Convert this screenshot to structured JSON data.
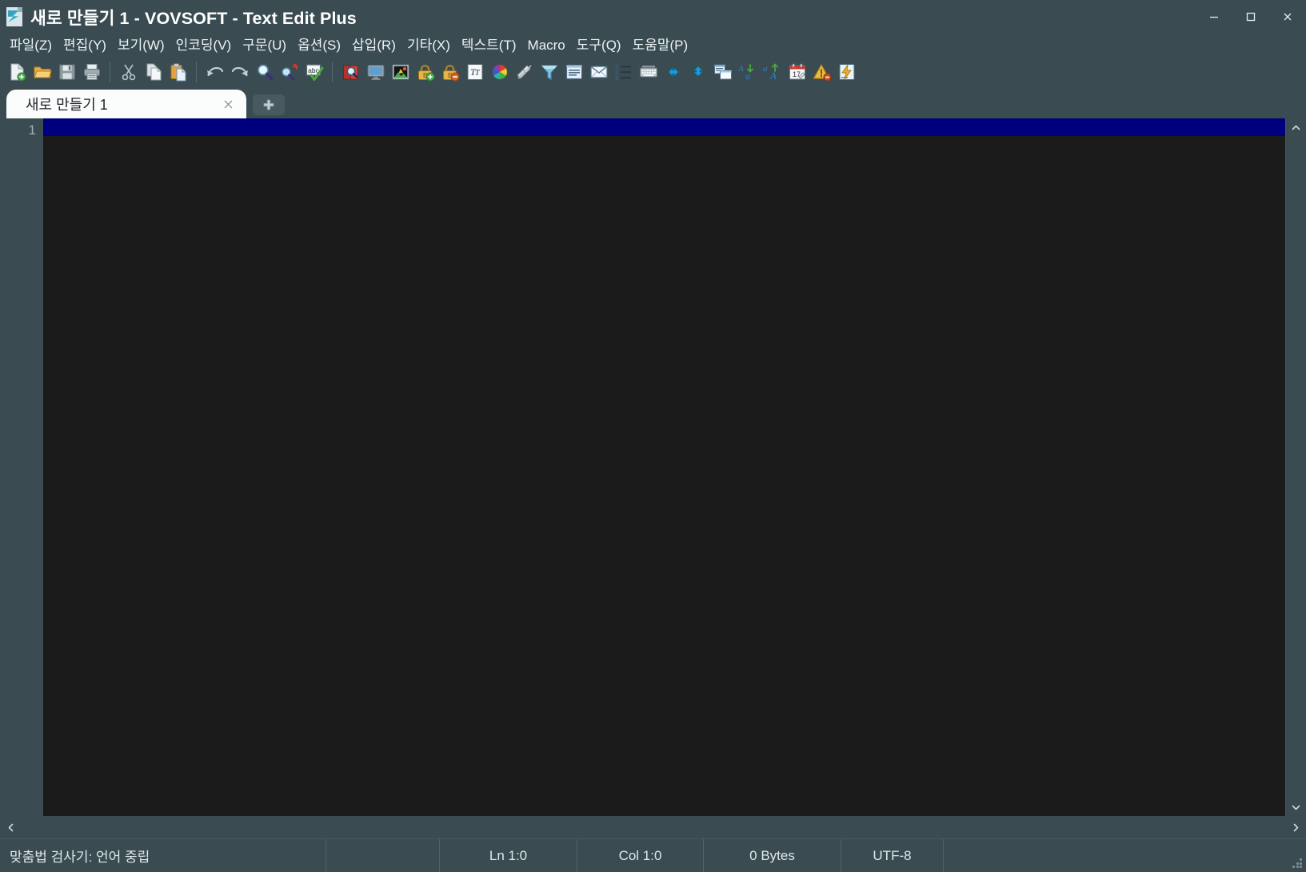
{
  "window": {
    "title": "새로 만들기 1 - VOVSOFT - Text Edit Plus",
    "icon": "document-app-icon",
    "controls": {
      "minimize": "minimize-button",
      "maximize": "maximize-button",
      "close": "close-button"
    },
    "background_color": "#3a4b52"
  },
  "menubar": {
    "items": [
      {
        "label": "파일(Z)"
      },
      {
        "label": "편집(Y)"
      },
      {
        "label": "보기(W)"
      },
      {
        "label": "인코딩(V)"
      },
      {
        "label": "구문(U)"
      },
      {
        "label": "옵션(S)"
      },
      {
        "label": "삽입(R)"
      },
      {
        "label": "기타(X)"
      },
      {
        "label": "텍스트(T)"
      },
      {
        "label": "Macro"
      },
      {
        "label": "도구(Q)"
      },
      {
        "label": "도움말(P)"
      }
    ]
  },
  "toolbar": {
    "groups": [
      {
        "buttons": [
          {
            "icon": "new-file-icon"
          },
          {
            "icon": "open-folder-icon"
          },
          {
            "icon": "save-icon"
          },
          {
            "icon": "print-icon"
          }
        ]
      },
      {
        "buttons": [
          {
            "icon": "cut-icon"
          },
          {
            "icon": "copy-icon"
          },
          {
            "icon": "paste-icon"
          }
        ]
      },
      {
        "buttons": [
          {
            "icon": "undo-icon"
          },
          {
            "icon": "redo-icon"
          },
          {
            "icon": "find-icon"
          },
          {
            "icon": "find-replace-icon"
          },
          {
            "icon": "spellcheck-icon"
          }
        ]
      },
      {
        "buttons": [
          {
            "icon": "dictionary-lookup-icon"
          },
          {
            "icon": "monitor-preview-icon"
          },
          {
            "icon": "image-icon"
          },
          {
            "icon": "encrypt-lock-icon"
          },
          {
            "icon": "decrypt-lock-icon"
          },
          {
            "icon": "font-format-icon"
          },
          {
            "icon": "color-wheel-icon"
          },
          {
            "icon": "pen-icon"
          },
          {
            "icon": "filter-funnel-icon"
          },
          {
            "icon": "lines-list-icon"
          },
          {
            "icon": "email-icon"
          },
          {
            "icon": "numbered-list-icon"
          },
          {
            "icon": "keyboard-icon"
          },
          {
            "icon": "horizontal-arrows-icon"
          },
          {
            "icon": "vertical-arrows-icon"
          },
          {
            "icon": "window-merge-icon"
          },
          {
            "icon": "sort-descending-icon"
          },
          {
            "icon": "sort-ascending-icon"
          },
          {
            "icon": "calendar-icon"
          },
          {
            "icon": "warning-triangle-icon"
          },
          {
            "icon": "macro-lightning-icon"
          }
        ]
      }
    ]
  },
  "tabs": {
    "items": [
      {
        "label": "새로 만들기 1",
        "active": true,
        "close_icon": "close-icon"
      }
    ],
    "add_tab_icon": "plus-icon"
  },
  "editor": {
    "line_numbers": [
      "1"
    ],
    "content": "",
    "current_line_color": "#00007f",
    "background_color": "#1b1b1b"
  },
  "scrollbars": {
    "vertical": {
      "up_icon": "chevron-up-icon",
      "down_icon": "chevron-down-icon"
    },
    "horizontal": {
      "left_icon": "chevron-left-icon",
      "right_icon": "chevron-right-icon"
    }
  },
  "statusbar": {
    "spellcheck": "맞춤법 검사기: 언어 중립",
    "blank": "",
    "line": "Ln 1:0",
    "column": "Col 1:0",
    "size": "0 Bytes",
    "encoding": "UTF-8",
    "rest": "",
    "grip": "resize-grip"
  }
}
